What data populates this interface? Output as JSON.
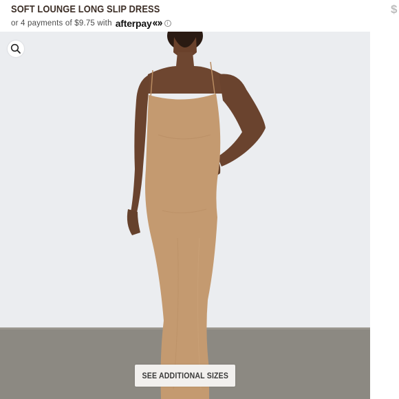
{
  "product": {
    "title": "SOFT LOUNGE LONG SLIP DRESS",
    "price_edge": "$"
  },
  "payment": {
    "prefix": "or 4 payments of $9.75 with",
    "provider": "afterpay",
    "info_glyph": "i"
  },
  "actions": {
    "sizes_label": "SEE ADDITIONAL SIZES"
  },
  "icons": {
    "zoom": "search-icon",
    "info": "info-icon",
    "afterpay_mark": "afterpay-logo-icon"
  },
  "colors": {
    "title": "#3d2f27",
    "dress": "#c49a70",
    "skin": "#6e4630",
    "backdrop": "#e8eaed",
    "floor": "#8b8880"
  }
}
